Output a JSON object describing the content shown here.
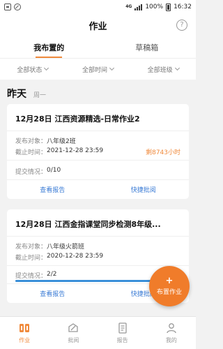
{
  "status_bar": {
    "network": "4G",
    "battery_text": "100%",
    "time": "16:32"
  },
  "header": {
    "title": "作业"
  },
  "tabs": [
    {
      "label": "我布置的",
      "active": true
    },
    {
      "label": "草稿箱",
      "active": false
    }
  ],
  "filters": [
    {
      "label": "全部状态"
    },
    {
      "label": "全部时间"
    },
    {
      "label": "全部班级"
    }
  ],
  "day_section": {
    "title": "昨天",
    "weekday": "周一"
  },
  "cards": [
    {
      "title": "12月28日  江西资源精选-日常作业2",
      "target_label": "发布对象：",
      "target_value": "八年级2班",
      "deadline_label": "截止时间：",
      "deadline_value": "2021-12-28 23:59",
      "remaining": "剩8743小时",
      "submission_label": "提交情况：",
      "submission_value": "0/10",
      "progress": 0,
      "action_report": "查看报告",
      "action_grade": "快捷批阅"
    },
    {
      "title": "12月28日  江西金指课堂同步检测8年级...",
      "target_label": "发布对象：",
      "target_value": "八年级火箭班",
      "deadline_label": "截止时间：",
      "deadline_value": "2020-12-28 23:59",
      "remaining": "",
      "submission_label": "提交情况：",
      "submission_value": "2/2",
      "progress": 1,
      "action_report": "查看报告",
      "action_grade": "快捷批阅"
    }
  ],
  "fab": {
    "label": "布置作业"
  },
  "bottom_nav": [
    {
      "label": "作业",
      "icon": "homework-icon",
      "active": true
    },
    {
      "label": "批阅",
      "icon": "grade-icon",
      "active": false
    },
    {
      "label": "报告",
      "icon": "report-icon",
      "active": false
    },
    {
      "label": "我的",
      "icon": "profile-icon",
      "active": false
    }
  ],
  "colors": {
    "accent": "#f08a3c",
    "link": "#3a7bd5",
    "progress": "#3a8fd9"
  }
}
